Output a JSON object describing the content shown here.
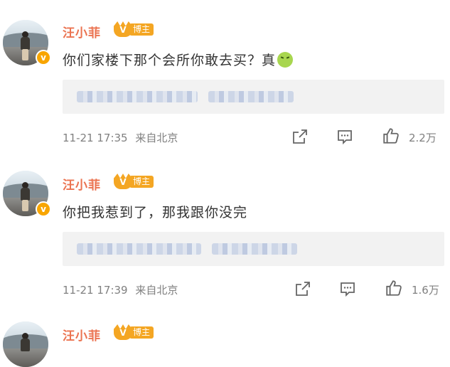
{
  "comments": [
    {
      "user": "汪小菲",
      "badge": "博主",
      "text": "你们家楼下那个会所你敢去买？真",
      "emoji": "nauseated-face",
      "timestamp": "11-21 17:35",
      "source": "来自北京",
      "likes": "2.2万"
    },
    {
      "user": "汪小菲",
      "badge": "博主",
      "text": "你把我惹到了，那我跟你没完",
      "timestamp": "11-21 17:39",
      "source": "来自北京",
      "likes": "1.6万"
    },
    {
      "user": "汪小菲",
      "badge": "博主"
    }
  ],
  "colors": {
    "username": "#eb7350",
    "badge": "#f4a623",
    "meta": "#808080",
    "quote_bg": "#f2f2f2"
  }
}
